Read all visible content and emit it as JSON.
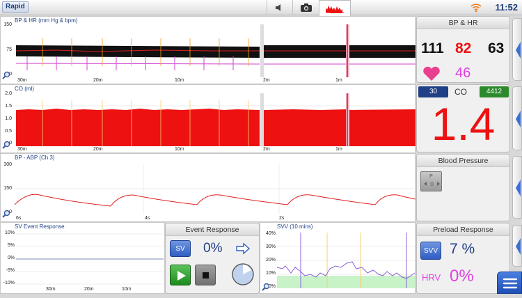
{
  "app": {
    "title": "Rapid",
    "clock": "11:52"
  },
  "tabs": [
    {
      "icon": "speaker-icon"
    },
    {
      "icon": "camera-icon"
    },
    {
      "icon": "trend-chart-icon",
      "active": true
    }
  ],
  "trend_bp_hr": {
    "title": "BP & HR (mm Hg & bpm)",
    "y_ticks": [
      "150",
      "75",
      "0"
    ],
    "x_ticks_left": [
      "30m",
      "20m",
      "10m"
    ],
    "x_ticks_right": [
      "2m",
      "1m"
    ]
  },
  "trend_co": {
    "title": "CO (ml)",
    "y_ticks": [
      "2.0",
      "1.5",
      "1.0",
      "0.5",
      "0"
    ],
    "x_ticks_left": [
      "30m",
      "20m",
      "10m"
    ],
    "x_ticks_right": [
      "2m",
      "1m"
    ]
  },
  "trend_abp": {
    "title": "BP - ABP (Ch 3)",
    "y_ticks": [
      "300",
      "150",
      "0"
    ],
    "x_ticks": [
      "6s",
      "4s",
      "2s"
    ]
  },
  "sv_event": {
    "title": "SV Event Response",
    "y_ticks": [
      "10%",
      "5%",
      "0%",
      "-5%",
      "-10%"
    ],
    "x_ticks": [
      "30m",
      "20m",
      "10m"
    ]
  },
  "event_response": {
    "title": "Event Response",
    "sv_label": "SV",
    "value": "0%"
  },
  "svv_trend": {
    "title": "SVV (10 mins)",
    "y_ticks": [
      "40%",
      "30%",
      "20%",
      "10%",
      "0%"
    ]
  },
  "bp_hr": {
    "title": "BP & HR",
    "systolic": "111",
    "mean": "82",
    "diastolic": "63",
    "hr": "46"
  },
  "co": {
    "left_badge": "30",
    "label": "CO",
    "right_badge": "4412",
    "value": "1.4"
  },
  "blood_pressure": {
    "title": "Blood Pressure",
    "icon_label": "P"
  },
  "preload": {
    "title": "Preload Response",
    "svv_label": "SVV",
    "svv_value": "7 %",
    "hrv_label": "HRV",
    "hrv_value": "0%"
  },
  "colors": {
    "accent_blue": "#1f3f86",
    "co_red": "#ee1111",
    "hr_magenta": "#e040e0",
    "green_badge": "#2c8a2c"
  }
}
